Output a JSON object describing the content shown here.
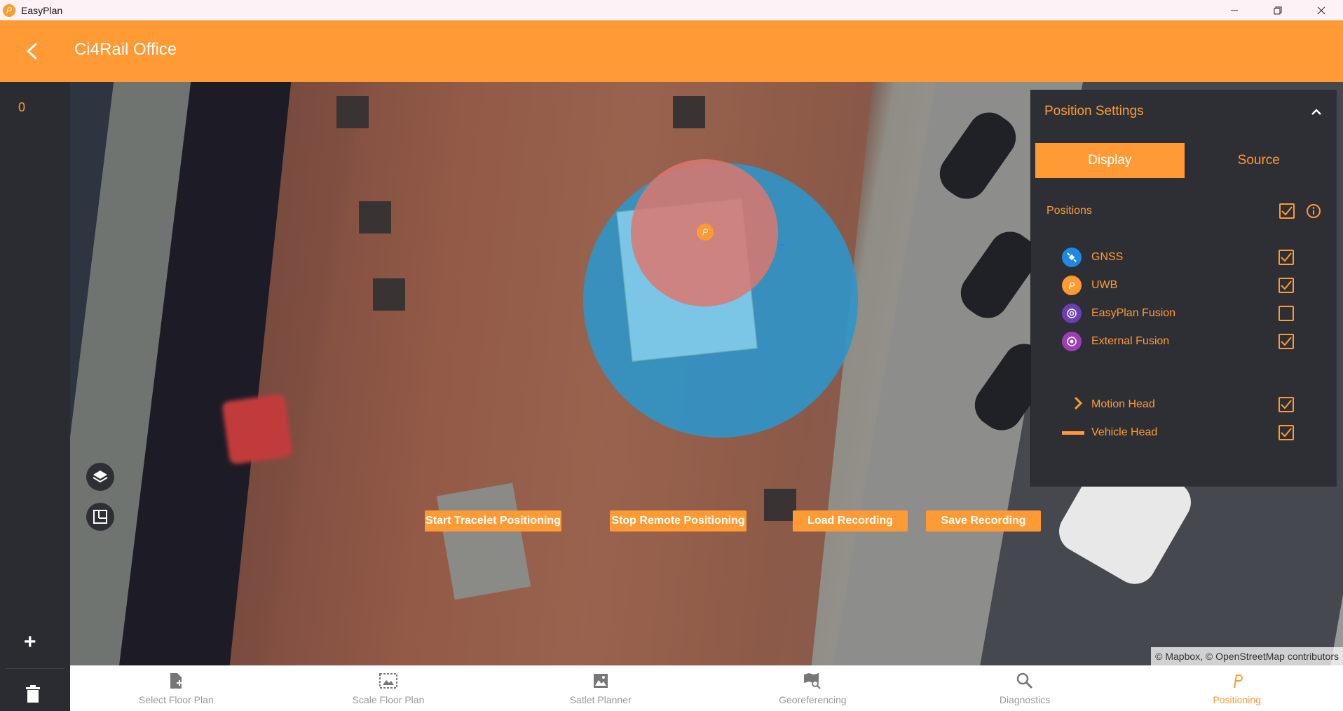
{
  "window": {
    "app_title": "EasyPlan"
  },
  "header": {
    "title": "Ci4Rail Office"
  },
  "sidebar": {
    "count": "0",
    "add_label": "+"
  },
  "map": {
    "attribution": "© Mapbox, © OpenStreetMap contributors",
    "uwb_marker_glyph": "P"
  },
  "actions": [
    {
      "label": "Start Tracelet Positioning"
    },
    {
      "label": "Stop Remote Positioning"
    },
    {
      "label": "Load Recording"
    },
    {
      "label": "Save Recording"
    }
  ],
  "panel": {
    "title": "Position Settings",
    "tabs": [
      {
        "label": "Display",
        "active": true
      },
      {
        "label": "Source",
        "active": false
      }
    ],
    "positions_label": "Positions",
    "positions_checked": true,
    "sources": [
      {
        "label": "GNSS",
        "icon": "satellite-icon",
        "color": "#1e88e5",
        "checked": true
      },
      {
        "label": "UWB",
        "icon": "uwb-icon",
        "color": "#ff9a34",
        "checked": true
      },
      {
        "label": "EasyPlan Fusion",
        "icon": "fusion-icon",
        "color": "#6a3fb5",
        "checked": false
      },
      {
        "label": "External Fusion",
        "icon": "external-fusion-icon",
        "color": "#9c3fb5",
        "checked": true
      }
    ],
    "heads": [
      {
        "label": "Motion Head",
        "icon": "chevron-right-icon",
        "checked": true
      },
      {
        "label": "Vehicle Head",
        "icon": "dash-icon",
        "checked": true
      }
    ]
  },
  "bottom_nav": [
    {
      "label": "Select Floor Plan",
      "icon": "file-add-icon",
      "active": false
    },
    {
      "label": "Scale Floor Plan",
      "icon": "scale-image-icon",
      "active": false
    },
    {
      "label": "Satlet Planner",
      "icon": "image-icon",
      "active": false
    },
    {
      "label": "Georeferencing",
      "icon": "map-search-icon",
      "active": false
    },
    {
      "label": "Diagnostics",
      "icon": "search-icon",
      "active": false
    },
    {
      "label": "Positioning",
      "icon": "positioning-icon",
      "active": true
    }
  ],
  "colors": {
    "accent": "#ff9a34",
    "panel_bg": "#2e2f34",
    "sidebar_bg": "#2a2c31"
  }
}
